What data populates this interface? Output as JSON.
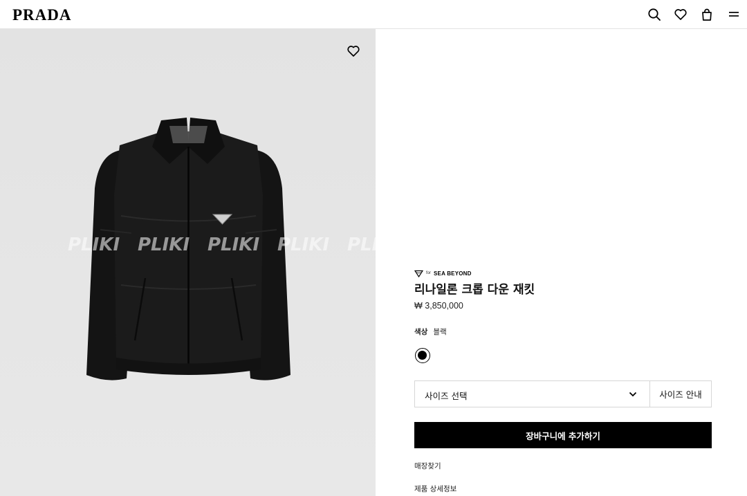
{
  "brand": {
    "logo_text": "PRADA"
  },
  "header": {
    "icons": [
      "search-icon",
      "heart-icon",
      "shopping-bag-icon",
      "menu-icon"
    ]
  },
  "gallery": {
    "watermark": [
      "PLIKI",
      "PLIKI",
      "PLIKI",
      "PLIKI",
      "PLI"
    ],
    "wishlist_icon": "heart-icon"
  },
  "product": {
    "collection_for": "for",
    "collection_name": "SEA BEYOND",
    "title": "리나일론 크롭 다운 재킷",
    "price": "₩ 3,850,000",
    "color_label": "색상",
    "color_value": "블랙",
    "swatch_color": "#000000",
    "size_select_label": "사이즈 선택",
    "size_guide_label": "사이즈 안내",
    "add_to_cart_label": "장바구니에 추가하기",
    "store_finder_label": "매장찾기",
    "details_label": "제품 상세정보"
  },
  "colors": {
    "accent": "#000000",
    "button_text": "#ffffff",
    "border": "#d6d6d6",
    "image_background": "#e5e5e5"
  }
}
